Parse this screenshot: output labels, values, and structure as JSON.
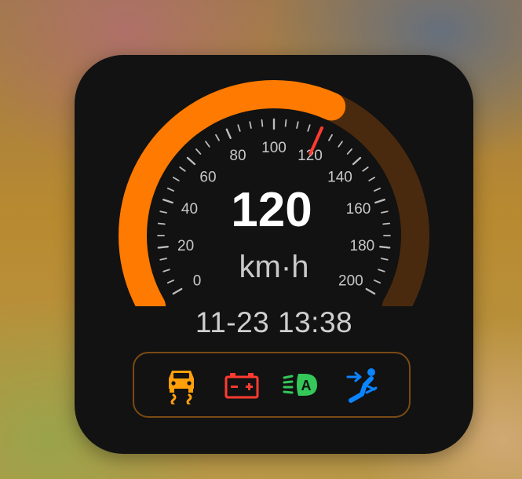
{
  "gauge": {
    "speed": "120",
    "unit": "km·h",
    "max": 200,
    "value": 120,
    "needle_value": 120,
    "tick_labels": [
      "0",
      "20",
      "40",
      "60",
      "80",
      "100",
      "120",
      "140",
      "160",
      "180",
      "200"
    ],
    "fill_color": "#FF7A00",
    "track_color": "#4A2A0E",
    "needle_color": "#FF3B30"
  },
  "datetime": "11-23 13:38",
  "indicators": [
    {
      "name": "traction-control-icon",
      "color": "#FF9F0A"
    },
    {
      "name": "battery-warning-icon",
      "color": "#FF3B30"
    },
    {
      "name": "auto-headlights-icon",
      "color": "#34C759"
    },
    {
      "name": "seatbelt-icon",
      "color": "#0A84FF"
    }
  ]
}
